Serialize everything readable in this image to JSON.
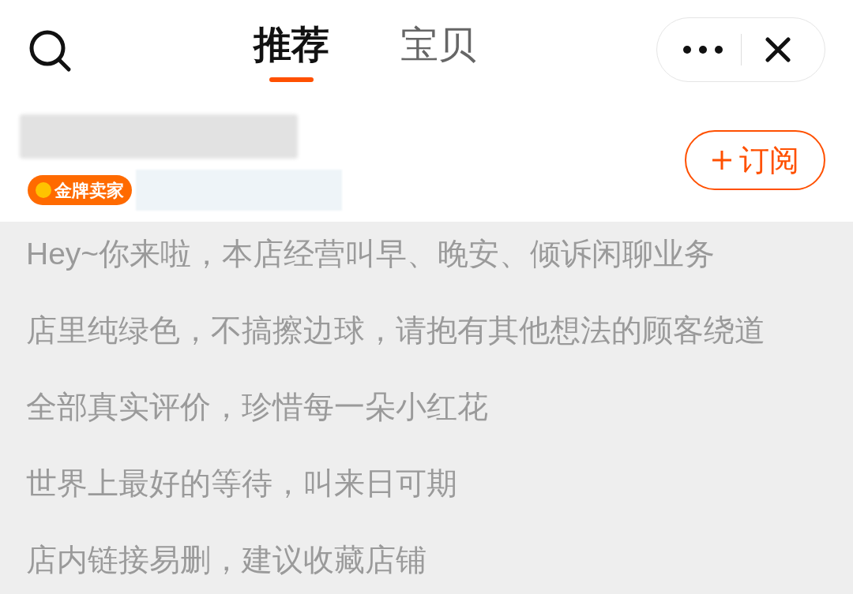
{
  "tabs": [
    {
      "label": "推荐",
      "selected": true
    },
    {
      "label": "宝贝",
      "selected": false
    }
  ],
  "shop": {
    "badge": "金牌卖家",
    "subscribe": "订阅"
  },
  "intro_lines": [
    "Hey~你来啦，本店经营叫早、晚安、倾诉闲聊业务",
    "店里纯绿色，不搞擦边球，请抱有其他想法的顾客绕道",
    "全部真实评价，珍惜每一朵小红花",
    "世界上最好的等待，叫来日可期",
    "店内链接易删，建议收藏店铺"
  ]
}
